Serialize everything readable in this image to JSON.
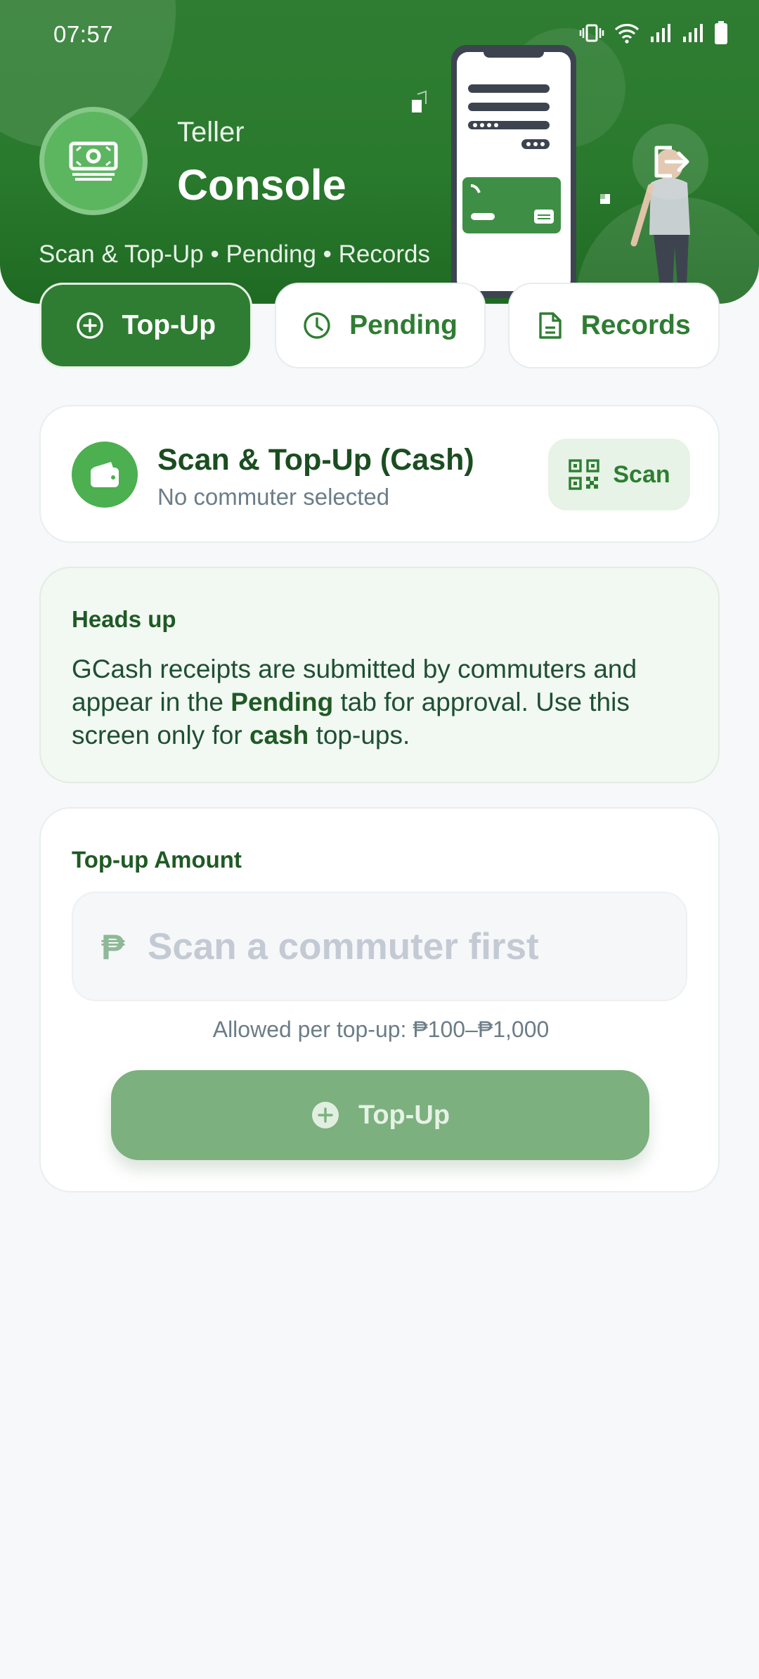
{
  "status_bar": {
    "time": "07:57"
  },
  "header": {
    "kicker": "Teller",
    "title": "Console",
    "subtitle": "Scan & Top-Up • Pending • Records"
  },
  "tabs": [
    {
      "label": "Top-Up",
      "icon": "plus-circle-icon",
      "active": true
    },
    {
      "label": "Pending",
      "icon": "clock-icon",
      "active": false
    },
    {
      "label": "Records",
      "icon": "document-icon",
      "active": false
    }
  ],
  "scan_card": {
    "title": "Scan & Top-Up (Cash)",
    "subtitle": "No commuter selected",
    "button_label": "Scan"
  },
  "notice": {
    "title": "Heads up",
    "text_1": "GCash receipts are submitted by commuters and appear in the ",
    "bold_1": "Pending",
    "text_2": " tab for approval. Use this screen only for ",
    "bold_2": "cash",
    "text_3": " top-ups."
  },
  "amount_card": {
    "label": "Top-up Amount",
    "currency_symbol": "₱",
    "input_value": "",
    "input_placeholder": "Scan a commuter first",
    "hint": "Allowed per top-up: ₱100–₱1,000",
    "button_label": "Top-Up"
  },
  "colors": {
    "brand_green": "#2f7d32",
    "accent_green": "#4caf50",
    "disabled_button": "#7cb07e",
    "background": "#f6f8f9"
  }
}
